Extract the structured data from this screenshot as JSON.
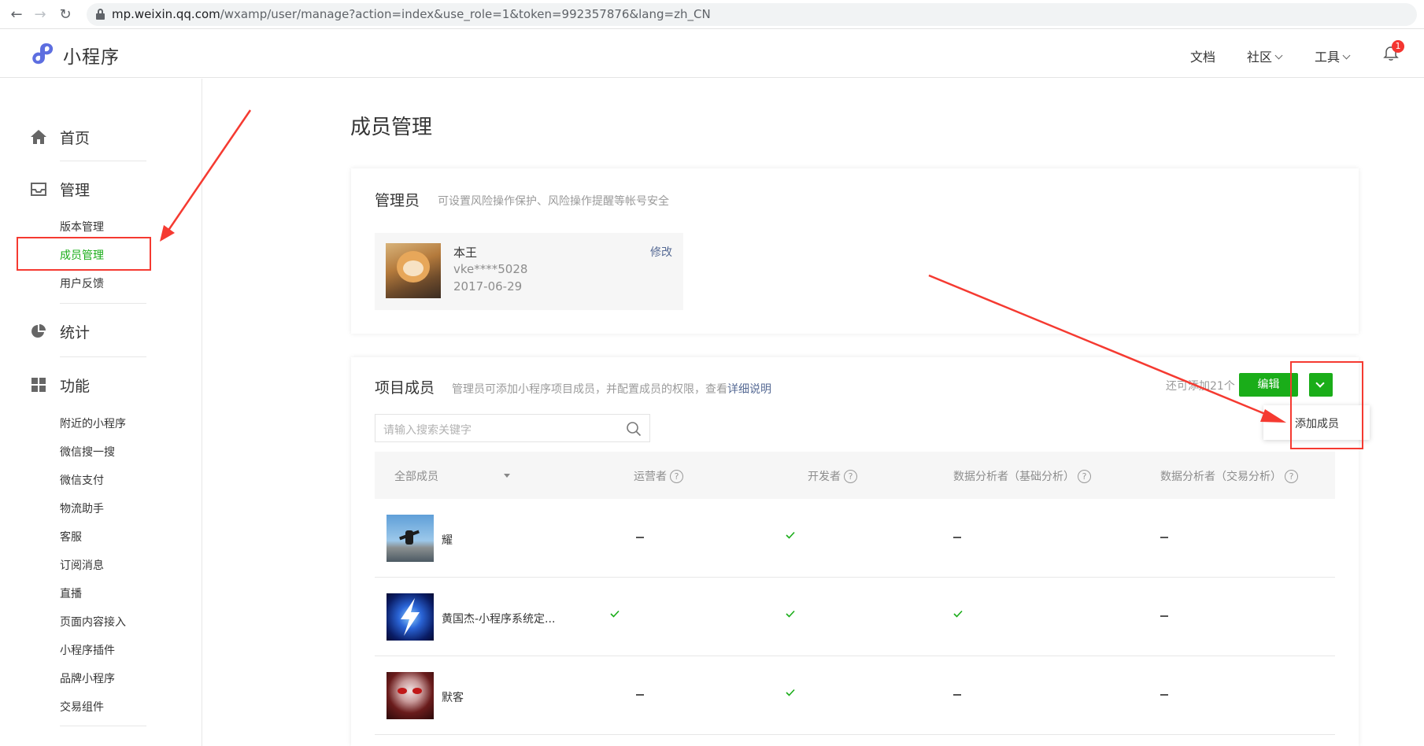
{
  "browser": {
    "url_host": "mp.weixin.qq.com",
    "url_path": "/wxamp/user/manage?action=index&use_role=1&token=992357876&lang=zh_CN"
  },
  "header": {
    "logo_text": "小程序",
    "nav": {
      "docs": "文档",
      "community": "社区",
      "tools": "工具"
    },
    "notification_count": "1"
  },
  "sidebar": {
    "home": "首页",
    "manage": "管理",
    "manage_items": [
      "版本管理",
      "成员管理",
      "用户反馈"
    ],
    "stats": "统计",
    "features": "功能",
    "feature_items": [
      "附近的小程序",
      "微信搜一搜",
      "微信支付",
      "物流助手",
      "客服",
      "订阅消息",
      "直播",
      "页面内容接入",
      "小程序插件",
      "品牌小程序",
      "交易组件"
    ]
  },
  "page": {
    "title": "成员管理"
  },
  "admin": {
    "title": "管理员",
    "desc": "可设置风险操作保护、风险操作提醒等帐号安全",
    "name": "本王",
    "account": "vke****5028",
    "date": "2017-06-29",
    "edit": "修改"
  },
  "members": {
    "title": "项目成员",
    "desc": "管理员可添加小程序项目成员，并配置成员的权限，查看",
    "desc_link": "详细说明",
    "remain": "还可添加21个",
    "edit_button": "编辑",
    "dropdown_item": "添加成员",
    "search_placeholder": "请输入搜索关键字",
    "columns": {
      "all": "全部成员",
      "operator": "运营者",
      "developer": "开发者",
      "analyst_basic": "数据分析者（基础分析）",
      "analyst_trade": "数据分析者（交易分析）"
    },
    "rows": [
      {
        "name": "耀",
        "operator": false,
        "developer": true,
        "analyst_basic": false,
        "analyst_trade": false
      },
      {
        "name": "黄国杰-小程序系统定...",
        "operator": true,
        "developer": true,
        "analyst_basic": true,
        "analyst_trade": false
      },
      {
        "name": "默客",
        "operator": false,
        "developer": true,
        "analyst_basic": false,
        "analyst_trade": false
      }
    ]
  },
  "colors": {
    "accent": "#1aad19",
    "link": "#576b95",
    "annotation": "#f53a31"
  }
}
